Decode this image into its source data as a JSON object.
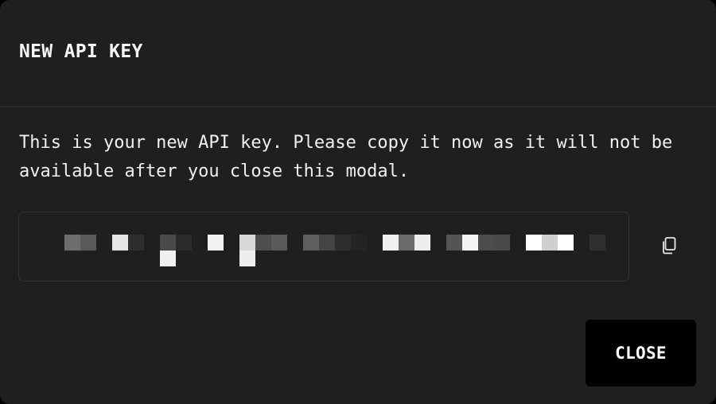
{
  "modal": {
    "title": "NEW API KEY",
    "message": "This is your new API key. Please copy it now as it will not be available after you close this modal.",
    "api_key": {
      "display": "redacted",
      "copy_icon": "copy-icon"
    },
    "close_label": "CLOSE"
  },
  "colors": {
    "modal_background": "#1f1f1f",
    "divider": "#2d2d2d",
    "field_border": "#333333",
    "button_background": "#000000",
    "text": "#f2f2f2"
  }
}
